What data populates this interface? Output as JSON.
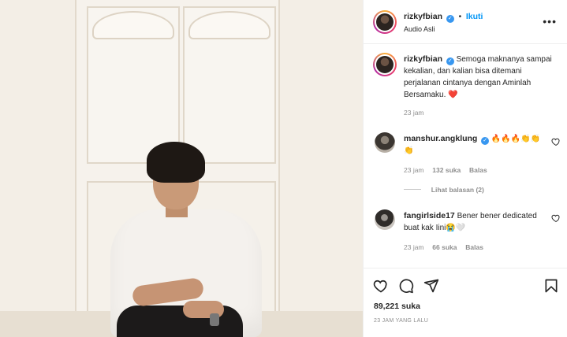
{
  "post": {
    "author": "rizkyfbian",
    "separator": "•",
    "follow_label": "Ikuti",
    "audio": "Audio Asli"
  },
  "caption": {
    "author": "rizkyfbian",
    "text": "Semoga maknanya sampai kekalian, dan kalian bisa ditemani perjalanan cintanya dengan Aminlah Bersamaku. ❤️",
    "time": "23 jam"
  },
  "comments": [
    {
      "author": "manshur.angklung",
      "verified": true,
      "text": "🔥🔥🔥👏👏 👏",
      "time": "23 jam",
      "likes": "132 suka",
      "reply": "Balas",
      "view_replies": "Lihat balasan (2)"
    },
    {
      "author": "fangirlside17",
      "verified": false,
      "text": "Bener bener dedicated buat kak Iini😭🤍",
      "time": "23 jam",
      "likes": "66 suka",
      "reply": "Balas"
    }
  ],
  "footer": {
    "likes": "89,221 suka",
    "timestamp": "23 JAM YANG LALU"
  },
  "icons": {
    "like": "heart-icon",
    "comment": "comment-icon",
    "share": "send-icon",
    "save": "bookmark-icon",
    "more": "more-options-icon"
  },
  "colors": {
    "accent": "#0095f6",
    "verified": "#3897f0",
    "text": "#262626",
    "muted": "#8e8e8e"
  }
}
